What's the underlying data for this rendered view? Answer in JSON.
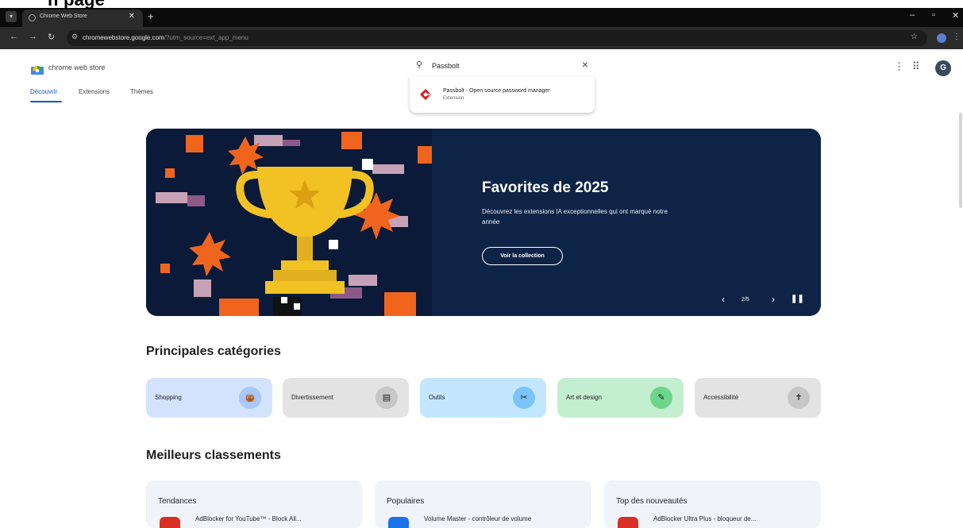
{
  "banner": {
    "text": "n page"
  },
  "browser": {
    "tab_title": "Chrome Web Store",
    "url_main": "chromewebstore.google.com",
    "url_rest": "/?utm_source=ext_app_menu",
    "profile_initial": "G"
  },
  "store": {
    "logo_text": "chrome web store",
    "tabs": [
      "Découvrir",
      "Extensions",
      "Thèmes"
    ],
    "account_initial": "G"
  },
  "search": {
    "value": "Passbolt",
    "suggestion": {
      "name": "Passbolt - Open source password manager",
      "type": "Extension"
    }
  },
  "hero": {
    "title": "Favorites de 2025",
    "description": "Découvrez les extensions IA exceptionnelles qui ont marqué notre année",
    "button": "Voir la collection",
    "page": "2/5",
    "colors": {
      "bg": "#0e2447",
      "accent": "#f0641e",
      "trophy": "#f2c224"
    }
  },
  "categories": {
    "heading": "Principales catégories",
    "items": [
      {
        "label": "Shopping",
        "icon": "shopping-bag-icon",
        "bg": "#d3e3fd",
        "circle": "#a8c7fa"
      },
      {
        "label": "Divertissement",
        "icon": "calendar-icon",
        "bg": "#e3e3e3",
        "circle": "#c7c7c7"
      },
      {
        "label": "Outils",
        "icon": "tools-icon",
        "bg": "#c2e7ff",
        "circle": "#7cc4f8"
      },
      {
        "label": "Art et design",
        "icon": "pencil-icon",
        "bg": "#c4eed0",
        "circle": "#6dd58c"
      },
      {
        "label": "Accessibilité",
        "icon": "accessibility-icon",
        "bg": "#e3e3e3",
        "circle": "#c7c7c7"
      }
    ]
  },
  "rankings": {
    "heading": "Meilleurs classements",
    "columns": [
      {
        "title": "Tendances",
        "first": "AdBlocker for YouTube™ - Block All...",
        "icon_color": "#d93025"
      },
      {
        "title": "Populaires",
        "first": "Volume Master - contrôleur de volume",
        "icon_color": "#1a73e8"
      },
      {
        "title": "Top des nouveautés",
        "first": "AdBlocker Ultra Plus - bloqueur de...",
        "icon_color": "#d93025"
      }
    ]
  }
}
